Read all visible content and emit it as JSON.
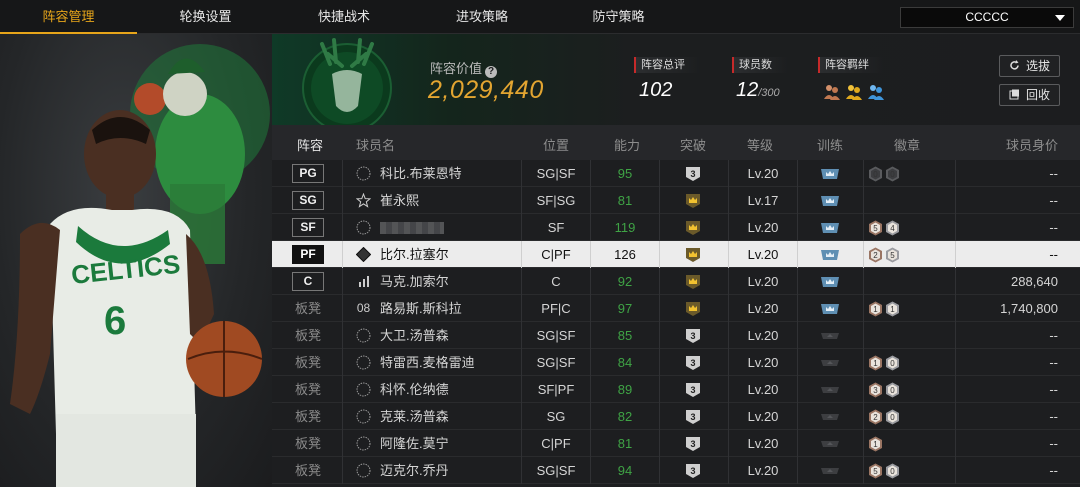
{
  "nav": {
    "tabs": [
      "阵容管理",
      "轮换设置",
      "快捷战术",
      "进攻策略",
      "防守策略"
    ],
    "active_tab": 0,
    "dropdown_value": "CCCCC"
  },
  "header": {
    "value_label": "阵容价值",
    "value": "2,029,440",
    "stats": [
      {
        "label": "阵容总评",
        "value": "102",
        "suffix": ""
      },
      {
        "label": "球员数",
        "value": "12",
        "suffix": "/300"
      },
      {
        "label": "阵容羁绊",
        "value": "",
        "suffix": ""
      }
    ],
    "buttons": {
      "pick": "选拔",
      "recycle": "回收"
    }
  },
  "table": {
    "headers": [
      "阵容",
      "球员名",
      "位置",
      "能力",
      "突破",
      "等级",
      "训练",
      "徽章",
      "球员身价"
    ],
    "rows": [
      {
        "slot": "PG",
        "bench": false,
        "icon": "copy",
        "name": "科比.布莱恩特",
        "position": "SG|SF",
        "ability": "95",
        "breakthrough": "3",
        "bt_type": "num",
        "level": "Lv.20",
        "train": true,
        "badges": [
          "0",
          "0"
        ],
        "badge_tone": "gray",
        "price": "--",
        "selected": false
      },
      {
        "slot": "SG",
        "bench": false,
        "icon": "star",
        "name": "崔永熙",
        "position": "SF|SG",
        "ability": "81",
        "breakthrough": "",
        "bt_type": "crown",
        "level": "Lv.17",
        "train": true,
        "badges": [],
        "badge_tone": "",
        "price": "--",
        "selected": false
      },
      {
        "slot": "SF",
        "bench": false,
        "icon": "copy",
        "name": "",
        "position": "SF",
        "ability": "119",
        "breakthrough": "",
        "bt_type": "crown",
        "level": "Lv.20",
        "train": true,
        "badges": [
          "5",
          "4"
        ],
        "badge_tone": "bronze",
        "price": "--",
        "selected": false,
        "blurred": true
      },
      {
        "slot": "PF",
        "bench": false,
        "icon": "diamond",
        "name": "比尔.拉塞尔",
        "position": "C|PF",
        "ability": "126",
        "breakthrough": "",
        "bt_type": "crown",
        "level": "Lv.20",
        "train": true,
        "badges": [
          "2",
          "5"
        ],
        "badge_tone": "bronze",
        "price": "--",
        "selected": true
      },
      {
        "slot": "C",
        "bench": false,
        "icon": "bars",
        "name": "马克.加索尔",
        "position": "C",
        "ability": "92",
        "breakthrough": "",
        "bt_type": "crown",
        "level": "Lv.20",
        "train": true,
        "badges": [],
        "badge_tone": "",
        "price": "288,640",
        "selected": false
      },
      {
        "slot": "板凳",
        "bench": true,
        "icon": "08",
        "name": "路易斯.斯科拉",
        "position": "PF|C",
        "ability": "97",
        "breakthrough": "",
        "bt_type": "crown",
        "level": "Lv.20",
        "train": true,
        "badges": [
          "1",
          "1"
        ],
        "badge_tone": "bronze",
        "price": "1,740,800",
        "selected": false
      },
      {
        "slot": "板凳",
        "bench": true,
        "icon": "copy",
        "name": "大卫.汤普森",
        "position": "SG|SF",
        "ability": "85",
        "breakthrough": "3",
        "bt_type": "num",
        "level": "Lv.20",
        "train": false,
        "badges": [],
        "badge_tone": "",
        "price": "--",
        "selected": false
      },
      {
        "slot": "板凳",
        "bench": true,
        "icon": "copy",
        "name": "特雷西.麦格雷迪",
        "position": "SG|SF",
        "ability": "84",
        "breakthrough": "3",
        "bt_type": "num",
        "level": "Lv.20",
        "train": false,
        "badges": [
          "1",
          "0"
        ],
        "badge_tone": "bronze",
        "price": "--",
        "selected": false
      },
      {
        "slot": "板凳",
        "bench": true,
        "icon": "copy",
        "name": "科怀.伦纳德",
        "position": "SF|PF",
        "ability": "89",
        "breakthrough": "3",
        "bt_type": "num",
        "level": "Lv.20",
        "train": false,
        "badges": [
          "3",
          "0"
        ],
        "badge_tone": "bronze",
        "price": "--",
        "selected": false
      },
      {
        "slot": "板凳",
        "bench": true,
        "icon": "copy",
        "name": "克莱.汤普森",
        "position": "SG",
        "ability": "82",
        "breakthrough": "3",
        "bt_type": "num",
        "level": "Lv.20",
        "train": false,
        "badges": [
          "2",
          "0"
        ],
        "badge_tone": "bronze",
        "price": "--",
        "selected": false
      },
      {
        "slot": "板凳",
        "bench": true,
        "icon": "copy",
        "name": "阿隆佐.莫宁",
        "position": "C|PF",
        "ability": "81",
        "breakthrough": "3",
        "bt_type": "num",
        "level": "Lv.20",
        "train": false,
        "badges": [
          "1"
        ],
        "badge_tone": "bronze",
        "price": "--",
        "selected": false
      },
      {
        "slot": "板凳",
        "bench": true,
        "icon": "copy",
        "name": "迈克尔.乔丹",
        "position": "SG|SF",
        "ability": "94",
        "breakthrough": "3",
        "bt_type": "num",
        "level": "Lv.20",
        "train": false,
        "badges": [
          "5",
          "0"
        ],
        "badge_tone": "bronze",
        "price": "--",
        "selected": false
      }
    ]
  },
  "colors": {
    "accent": "#e7a51a",
    "value_gold": "#e3a531",
    "ability_green": "#3fa345",
    "stat_red": "#c62a2a"
  },
  "player_art": {
    "jersey_text": "CELTICS",
    "jersey_number": "6"
  }
}
